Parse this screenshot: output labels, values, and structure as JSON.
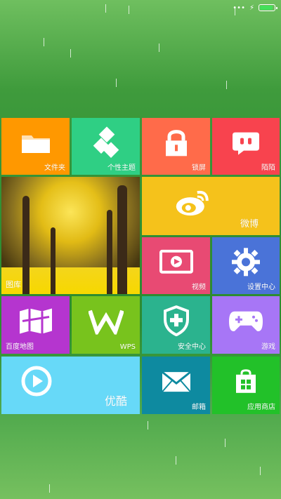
{
  "status": {
    "indicators": "•••"
  },
  "tiles": [
    {
      "label": "文件夹",
      "color": "#ff9800"
    },
    {
      "label": "个性主题",
      "color": "#2fcf84"
    },
    {
      "label": "锁屏",
      "color": "#ff6b4a"
    },
    {
      "label": "陌陌",
      "color": "#f8434e"
    },
    {
      "label": "图库",
      "color": "#d7b000"
    },
    {
      "label": "微博",
      "color": "#f5c21b"
    },
    {
      "label": "视频",
      "color": "#e84a73"
    },
    {
      "label": "设置中心",
      "color": "#4a73d8"
    },
    {
      "label": "百度地图",
      "color": "#b535cf"
    },
    {
      "label": "WPS",
      "color": "#78c31d"
    },
    {
      "label": "安全中心",
      "color": "#2bb38e"
    },
    {
      "label": "游戏",
      "color": "#a776f6"
    },
    {
      "label": "优酷",
      "color": "#67d9f8"
    },
    {
      "label": "邮箱",
      "color": "#0e8aa0"
    },
    {
      "label": "应用商店",
      "color": "#22c129"
    }
  ]
}
